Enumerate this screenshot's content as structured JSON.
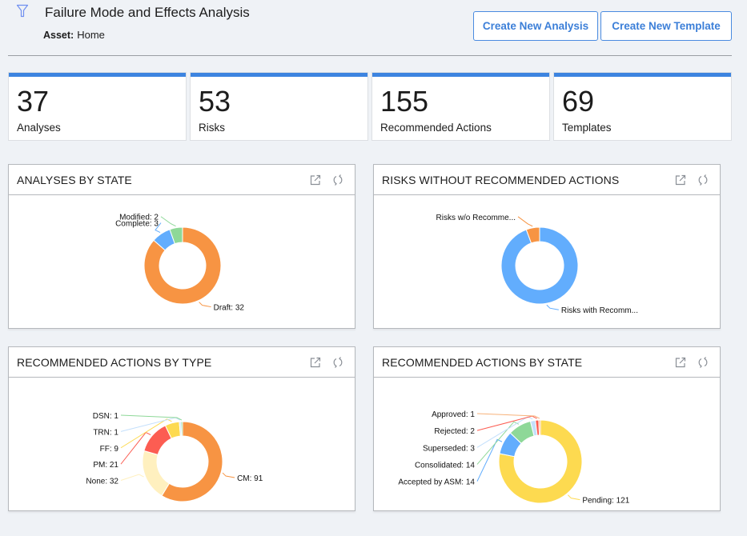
{
  "header": {
    "title": "Failure Mode and Effects Analysis",
    "asset_label": "Asset:",
    "asset_value": "Home",
    "filter_icon": "filter-funnel-icon",
    "buttons": {
      "create_analysis": "Create New Analysis",
      "create_template": "Create New Template"
    }
  },
  "kpis": [
    {
      "value": "37",
      "label": "Analyses"
    },
    {
      "value": "53",
      "label": "Risks"
    },
    {
      "value": "155",
      "label": "Recommended Actions"
    },
    {
      "value": "69",
      "label": "Templates"
    }
  ],
  "colors": {
    "accent": "#3d84e0",
    "button_text": "#3c7fd8"
  },
  "card_icons": [
    "open-external-icon",
    "refresh-icon"
  ],
  "chart_data": [
    {
      "type": "pie",
      "variant": "donut",
      "title": "ANALYSES BY STATE",
      "slices": [
        {
          "label": "Draft",
          "value": 32,
          "display": "Draft: 32",
          "color": "#f79443"
        },
        {
          "label": "Complete",
          "value": 3,
          "display": "Complete: 3",
          "color": "#62adfd"
        },
        {
          "label": "Modified",
          "value": 2,
          "display": "Modified: 2",
          "color": "#8ed898"
        }
      ]
    },
    {
      "type": "pie",
      "variant": "donut",
      "title": "RISKS WITHOUT RECOMMENDED ACTIONS",
      "slices": [
        {
          "label": "Risks with Recommended Actions",
          "value": 50,
          "display": "Risks with Recomm...",
          "color": "#62adfd"
        },
        {
          "label": "Risks w/o Recommended Actions",
          "value": 3,
          "display": "Risks w/o Recomme...",
          "color": "#f79443"
        }
      ]
    },
    {
      "type": "pie",
      "variant": "donut",
      "title": "RECOMMENDED ACTIONS BY TYPE",
      "slices": [
        {
          "label": "CM",
          "value": 91,
          "display": "CM: 91",
          "color": "#f79443"
        },
        {
          "label": "None",
          "value": 32,
          "display": "None: 32",
          "color": "#fff0bf"
        },
        {
          "label": "PM",
          "value": 21,
          "display": "PM: 21",
          "color": "#fc5d52"
        },
        {
          "label": "FF",
          "value": 9,
          "display": "FF: 9",
          "color": "#fdda50"
        },
        {
          "label": "TRN",
          "value": 1,
          "display": "TRN: 1",
          "color": "#c4e0fc"
        },
        {
          "label": "DSN",
          "value": 1,
          "display": "DSN: 1",
          "color": "#8ed898"
        }
      ]
    },
    {
      "type": "pie",
      "variant": "donut",
      "title": "RECOMMENDED ACTIONS BY STATE",
      "slices": [
        {
          "label": "Pending",
          "value": 121,
          "display": "Pending: 121",
          "color": "#fdda50"
        },
        {
          "label": "Accepted by ASM",
          "value": 14,
          "display": "Accepted by ASM: 14",
          "color": "#62adfd"
        },
        {
          "label": "Consolidated",
          "value": 14,
          "display": "Consolidated: 14",
          "color": "#8ed898"
        },
        {
          "label": "Superseded",
          "value": 3,
          "display": "Superseded: 3",
          "color": "#c4e0fc"
        },
        {
          "label": "Rejected",
          "value": 2,
          "display": "Rejected: 2",
          "color": "#fc5d52"
        },
        {
          "label": "Approved",
          "value": 1,
          "display": "Approved: 1",
          "color": "#f7b27a"
        }
      ]
    }
  ]
}
